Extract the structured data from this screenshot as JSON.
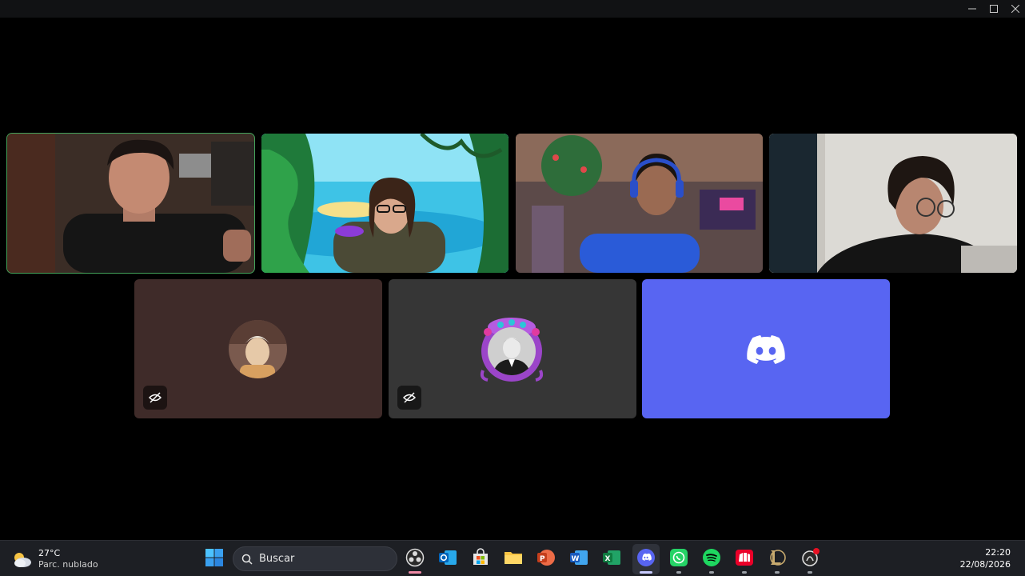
{
  "window": {
    "controls": [
      "minimize-icon",
      "maximize-icon",
      "close-icon"
    ]
  },
  "call": {
    "speaking_color": "#43a25a",
    "tiles": [
      {
        "kind": "video",
        "speaking": true
      },
      {
        "kind": "video",
        "speaking": false
      },
      {
        "kind": "video",
        "speaking": false
      },
      {
        "kind": "video",
        "speaking": false
      },
      {
        "kind": "avatar",
        "bg": "#3f2b29",
        "muted_icon": "camera-off-icon"
      },
      {
        "kind": "avatar",
        "bg": "#363636",
        "muted_icon": "camera-off-icon"
      },
      {
        "kind": "logo",
        "bg": "#5865f2",
        "icon": "discord-logo-icon"
      }
    ]
  },
  "taskbar": {
    "weather": {
      "temp": "27°C",
      "desc": "Parc. nublado",
      "icon": "partly-cloudy-icon"
    },
    "search": {
      "label": "Buscar",
      "icon": "search-icon"
    },
    "apps": [
      "start-icon",
      "obs-icon",
      "outlook-icon",
      "store-icon",
      "file-explorer-icon",
      "powerpoint-icon",
      "word-icon",
      "excel-icon",
      "discord-icon",
      "whatsapp-icon",
      "spotify-icon",
      "riot-client-icon",
      "league-icon",
      "overwolf-icon"
    ],
    "clock": {
      "time": "22:20",
      "date": "22/08/2026"
    }
  }
}
